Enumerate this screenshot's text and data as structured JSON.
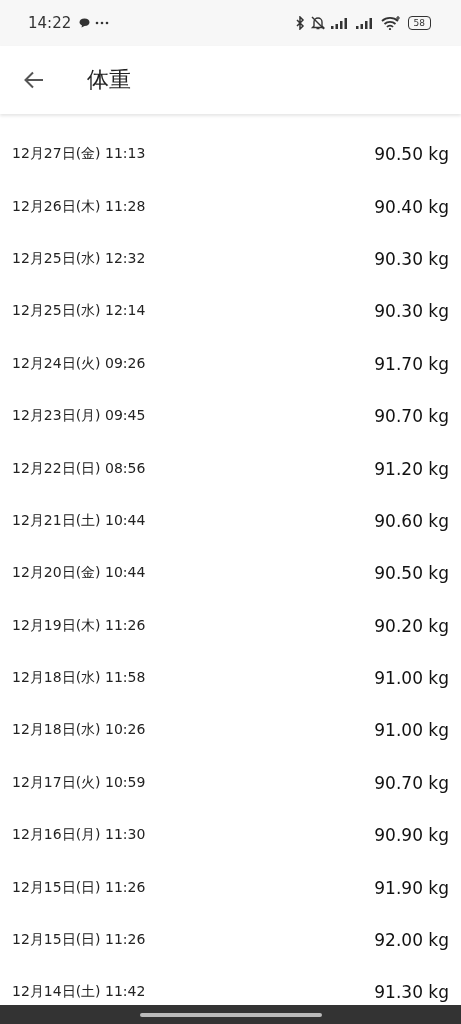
{
  "status_bar": {
    "time": "14:22",
    "battery": "58"
  },
  "header": {
    "title": "体重"
  },
  "entries": [
    {
      "date": "12月27日(金) 11:13",
      "weight": "90.50 kg"
    },
    {
      "date": "12月26日(木) 11:28",
      "weight": "90.40 kg"
    },
    {
      "date": "12月25日(水) 12:32",
      "weight": "90.30 kg"
    },
    {
      "date": "12月25日(水) 12:14",
      "weight": "90.30 kg"
    },
    {
      "date": "12月24日(火) 09:26",
      "weight": "91.70 kg"
    },
    {
      "date": "12月23日(月) 09:45",
      "weight": "90.70 kg"
    },
    {
      "date": "12月22日(日) 08:56",
      "weight": "91.20 kg"
    },
    {
      "date": "12月21日(土) 10:44",
      "weight": "90.60 kg"
    },
    {
      "date": "12月20日(金) 10:44",
      "weight": "90.50 kg"
    },
    {
      "date": "12月19日(木) 11:26",
      "weight": "90.20 kg"
    },
    {
      "date": "12月18日(水) 11:58",
      "weight": "91.00 kg"
    },
    {
      "date": "12月18日(水) 10:26",
      "weight": "91.00 kg"
    },
    {
      "date": "12月17日(火) 10:59",
      "weight": "90.70 kg"
    },
    {
      "date": "12月16日(月) 11:30",
      "weight": "90.90 kg"
    },
    {
      "date": "12月15日(日) 11:26",
      "weight": "91.90 kg"
    },
    {
      "date": "12月15日(日) 11:26",
      "weight": "92.00 kg"
    },
    {
      "date": "12月14日(土) 11:42",
      "weight": "91.30 kg"
    }
  ]
}
